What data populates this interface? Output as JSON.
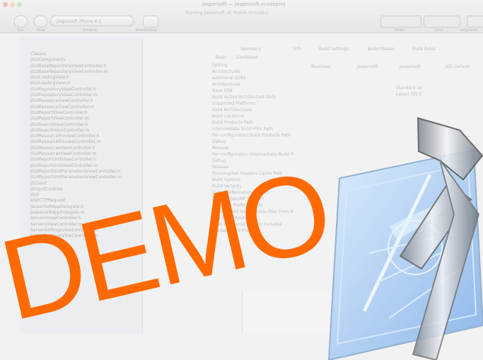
{
  "window": {
    "title": "Jaspersoft — Jaspersoft.xcodeproj",
    "subtitle": "Running Jaspersoft on Mobile Simulator"
  },
  "toolbar": {
    "scheme_label": "Jaspersoft",
    "scheme_device": "iPhone 6.1",
    "labels": {
      "run": "Run",
      "stop": "Stop",
      "scheme": "Scheme",
      "breakpoints": "Breakpoints",
      "editor": "Editor",
      "view": "View",
      "organizer": "Organizer"
    }
  },
  "navigator": {
    "items": [
      "Classes",
      "JSUIComponents",
      "JSUIBaseRepositoryViewController.h",
      "JSUIBaseRepositoryViewController.m",
      "JSUILoadingView.h",
      "JSUILoadingView.m",
      "JSUIRepositoryViewController.h",
      "JSUIRepositoryViewController.m",
      "JSUIResourceViewController.h",
      "JSUIResourceViewController.m",
      "JSUIReportViewController.h",
      "JSUIReportViewController.m",
      "JSUISearchViewController.h",
      "JSUISearchViewController.m",
      "JSUIResourcePreviewController.h",
      "JSUIResourcePreviewController.m",
      "JSUIResourcesViewController.h",
      "JSUIResourcesViewController.m",
      "JSUIReportUnitViewController.h",
      "JSUIReportUnitViewController.m",
      "JSUIReportUnitParametersViewController.h",
      "JSUIReportUnitParametersViewController.m",
      "JSClient",
      "JSInputControls",
      "JSUI",
      "ASIHTTPRequest",
      "JasperSoftAppDelegate.h",
      "JaspersoftAppDelegate.m",
      "ServersViewController.h",
      "ServersViewController.m",
      "ServerSettingsViewController.h",
      "ServerSettingsViewController.m"
    ]
  },
  "editor": {
    "tabs": [
      "Summary",
      "Info",
      "Build Settings",
      "Build Phases",
      "Build Rules"
    ],
    "segments": [
      "Basic",
      "Combined"
    ],
    "settings": [
      "Setting",
      "Architectures",
      "Additional SDKs",
      "Architectures",
      "Base SDK",
      "Build Active Architecture Only",
      "Supported Platforms",
      "Valid Architectures",
      "Build Locations",
      "Build Products Path",
      "Intermediate Build Files Path",
      "Per-configuration Build Products Path",
      "Debug",
      "Release",
      "Per-configuration Intermediate Build Fi",
      "Debug",
      "Release",
      "Precompiled Headers Cache Path",
      "Build Options",
      "Build Variants",
      "Debug Information Format",
      "Enable OpenMP Support",
      "Generate Profiling Code",
      "Precompiled Header Uses Files From B",
      "Run Static Analyzer",
      "Scan All Source Files for Includes",
      "Validate Built Product"
    ],
    "values": [
      "Resolved",
      "Jaspersoft",
      "Jaspersoft",
      "iOS Default",
      "Standard (ar",
      "Latest iOS (i"
    ]
  },
  "watermark": {
    "text": "DEMO",
    "color": "#ff6a00"
  }
}
